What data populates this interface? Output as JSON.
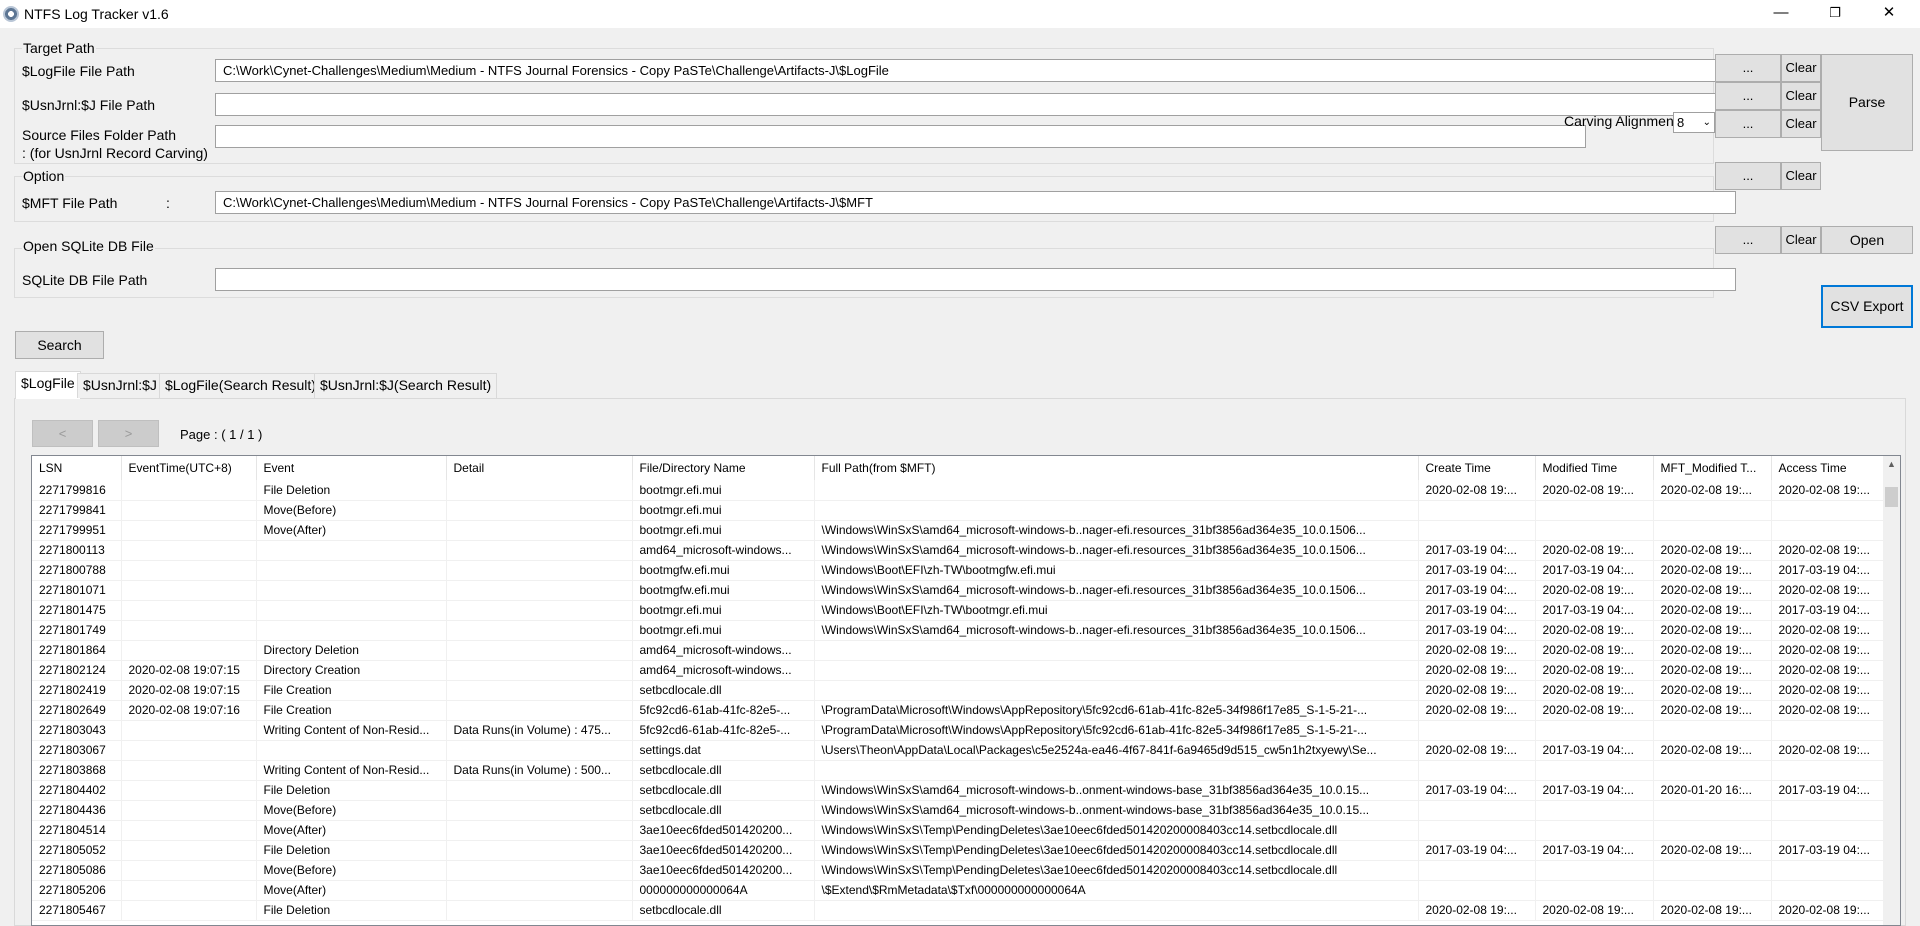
{
  "window": {
    "title": "NTFS Log Tracker v1.6",
    "minimize_glyph": "—",
    "maximize_glyph": "❐",
    "close_glyph": "✕"
  },
  "target_path": {
    "group_label": "Target Path",
    "logfile_label": "$LogFile File Path",
    "logfile_value": "C:\\Work\\Cynet-Challenges\\Medium\\Medium - NTFS Journal Forensics - Copy PaSTe\\Challenge\\Artifacts-J\\$LogFile",
    "usnjrnl_label": "$UsnJrnl:$J File Path",
    "usnjrnl_value": "",
    "source_label_line1": "Source Files Folder Path",
    "source_label_line2": ": (for UsnJrnl Record Carving)",
    "source_value": "",
    "carving_label": "Carving Alignment",
    "carving_value": "8",
    "browse_label": "...",
    "clear_label": "Clear",
    "parse_label": "Parse"
  },
  "option": {
    "group_label": "Option",
    "mft_label": "$MFT File Path",
    "mft_colon": ":",
    "mft_value": "C:\\Work\\Cynet-Challenges\\Medium\\Medium - NTFS Journal Forensics - Copy PaSTe\\Challenge\\Artifacts-J\\$MFT",
    "browse_label": "...",
    "clear_label": "Clear"
  },
  "sqlite": {
    "group_label": "Open SQLite DB File",
    "db_label": "SQLite DB File Path",
    "db_value": "",
    "browse_label": "...",
    "clear_label": "Clear",
    "open_label": "Open",
    "csv_label": "CSV Export"
  },
  "search_label": "Search",
  "tabs": [
    "$LogFile",
    "$UsnJrnl:$J",
    "$LogFile(Search Result)",
    "$UsnJrnl:$J(Search Result)"
  ],
  "pager": {
    "prev": "<",
    "next": ">",
    "page_text": "Page : ( 1 / 1 )"
  },
  "table": {
    "columns": [
      "LSN",
      "EventTime(UTC+8)",
      "Event",
      "Detail",
      "File/Directory Name",
      "Full Path(from $MFT)",
      "Create Time",
      "Modified Time",
      "MFT_Modified T...",
      "Access Time"
    ],
    "rows": [
      [
        "2271799816",
        "",
        "File Deletion",
        "",
        "bootmgr.efi.mui",
        "",
        "2020-02-08 19:...",
        "2020-02-08 19:...",
        "2020-02-08 19:...",
        "2020-02-08 19:..."
      ],
      [
        "2271799841",
        "",
        "Move(Before)",
        "",
        "bootmgr.efi.mui",
        "",
        "",
        "",
        "",
        ""
      ],
      [
        "2271799951",
        "",
        "Move(After)",
        "",
        "bootmgr.efi.mui",
        "\\Windows\\WinSxS\\amd64_microsoft-windows-b..nager-efi.resources_31bf3856ad364e35_10.0.1506...",
        "",
        "",
        "",
        ""
      ],
      [
        "2271800113",
        "",
        "",
        "",
        "amd64_microsoft-windows...",
        "\\Windows\\WinSxS\\amd64_microsoft-windows-b..nager-efi.resources_31bf3856ad364e35_10.0.1506...",
        "2017-03-19 04:...",
        "2020-02-08 19:...",
        "2020-02-08 19:...",
        "2020-02-08 19:..."
      ],
      [
        "2271800788",
        "",
        "",
        "",
        "bootmgfw.efi.mui",
        "\\Windows\\Boot\\EFI\\zh-TW\\bootmgfw.efi.mui",
        "2017-03-19 04:...",
        "2017-03-19 04:...",
        "2020-02-08 19:...",
        "2017-03-19 04:..."
      ],
      [
        "2271801071",
        "",
        "",
        "",
        "bootmgfw.efi.mui",
        "\\Windows\\WinSxS\\amd64_microsoft-windows-b..nager-efi.resources_31bf3856ad364e35_10.0.1506...",
        "2017-03-19 04:...",
        "2020-02-08 19:...",
        "2020-02-08 19:...",
        "2020-02-08 19:..."
      ],
      [
        "2271801475",
        "",
        "",
        "",
        "bootmgr.efi.mui",
        "\\Windows\\Boot\\EFI\\zh-TW\\bootmgr.efi.mui",
        "2017-03-19 04:...",
        "2017-03-19 04:...",
        "2020-02-08 19:...",
        "2017-03-19 04:..."
      ],
      [
        "2271801749",
        "",
        "",
        "",
        "bootmgr.efi.mui",
        "\\Windows\\WinSxS\\amd64_microsoft-windows-b..nager-efi.resources_31bf3856ad364e35_10.0.1506...",
        "2017-03-19 04:...",
        "2020-02-08 19:...",
        "2020-02-08 19:...",
        "2020-02-08 19:..."
      ],
      [
        "2271801864",
        "",
        "Directory Deletion",
        "",
        "amd64_microsoft-windows...",
        "",
        "2020-02-08 19:...",
        "2020-02-08 19:...",
        "2020-02-08 19:...",
        "2020-02-08 19:..."
      ],
      [
        "2271802124",
        "2020-02-08 19:07:15",
        "Directory Creation",
        "",
        "amd64_microsoft-windows...",
        "",
        "2020-02-08 19:...",
        "2020-02-08 19:...",
        "2020-02-08 19:...",
        "2020-02-08 19:..."
      ],
      [
        "2271802419",
        "2020-02-08 19:07:15",
        "File Creation",
        "",
        "setbcdlocale.dll",
        "",
        "2020-02-08 19:...",
        "2020-02-08 19:...",
        "2020-02-08 19:...",
        "2020-02-08 19:..."
      ],
      [
        "2271802649",
        "2020-02-08 19:07:16",
        "File Creation",
        "",
        "5fc92cd6-61ab-41fc-82e5-...",
        "\\ProgramData\\Microsoft\\Windows\\AppRepository\\5fc92cd6-61ab-41fc-82e5-34f986f17e85_S-1-5-21-...",
        "2020-02-08 19:...",
        "2020-02-08 19:...",
        "2020-02-08 19:...",
        "2020-02-08 19:..."
      ],
      [
        "2271803043",
        "",
        "Writing Content of Non-Resid...",
        "Data Runs(in Volume) : 475...",
        "5fc92cd6-61ab-41fc-82e5-...",
        "\\ProgramData\\Microsoft\\Windows\\AppRepository\\5fc92cd6-61ab-41fc-82e5-34f986f17e85_S-1-5-21-...",
        "",
        "",
        "",
        ""
      ],
      [
        "2271803067",
        "",
        "",
        "",
        "settings.dat",
        "\\Users\\Theon\\AppData\\Local\\Packages\\c5e2524a-ea46-4f67-841f-6a9465d9d515_cw5n1h2txyewy\\Se...",
        "2020-02-08 19:...",
        "2017-03-19 04:...",
        "2020-02-08 19:...",
        "2020-02-08 19:..."
      ],
      [
        "2271803868",
        "",
        "Writing Content of Non-Resid...",
        "Data Runs(in Volume) : 500...",
        "setbcdlocale.dll",
        "",
        "",
        "",
        "",
        ""
      ],
      [
        "2271804402",
        "",
        "File Deletion",
        "",
        "setbcdlocale.dll",
        "\\Windows\\WinSxS\\amd64_microsoft-windows-b..onment-windows-base_31bf3856ad364e35_10.0.15...",
        "2017-03-19 04:...",
        "2017-03-19 04:...",
        "2020-01-20 16:...",
        "2017-03-19 04:..."
      ],
      [
        "2271804436",
        "",
        "Move(Before)",
        "",
        "setbcdlocale.dll",
        "\\Windows\\WinSxS\\amd64_microsoft-windows-b..onment-windows-base_31bf3856ad364e35_10.0.15...",
        "",
        "",
        "",
        ""
      ],
      [
        "2271804514",
        "",
        "Move(After)",
        "",
        "3ae10eec6fded501420200...",
        "\\Windows\\WinSxS\\Temp\\PendingDeletes\\3ae10eec6fded501420200008403cc14.setbcdlocale.dll",
        "",
        "",
        "",
        ""
      ],
      [
        "2271805052",
        "",
        "File Deletion",
        "",
        "3ae10eec6fded501420200...",
        "\\Windows\\WinSxS\\Temp\\PendingDeletes\\3ae10eec6fded501420200008403cc14.setbcdlocale.dll",
        "2017-03-19 04:...",
        "2017-03-19 04:...",
        "2020-02-08 19:...",
        "2017-03-19 04:..."
      ],
      [
        "2271805086",
        "",
        "Move(Before)",
        "",
        "3ae10eec6fded501420200...",
        "\\Windows\\WinSxS\\Temp\\PendingDeletes\\3ae10eec6fded501420200008403cc14.setbcdlocale.dll",
        "",
        "",
        "",
        ""
      ],
      [
        "2271805206",
        "",
        "Move(After)",
        "",
        "000000000000064A",
        "\\$Extend\\$RmMetadata\\$Txf\\000000000000064A",
        "",
        "",
        "",
        ""
      ],
      [
        "2271805467",
        "",
        "File Deletion",
        "",
        "setbcdlocale.dll",
        "",
        "2020-02-08 19:...",
        "2020-02-08 19:...",
        "2020-02-08 19:...",
        "2020-02-08 19:..."
      ]
    ]
  }
}
